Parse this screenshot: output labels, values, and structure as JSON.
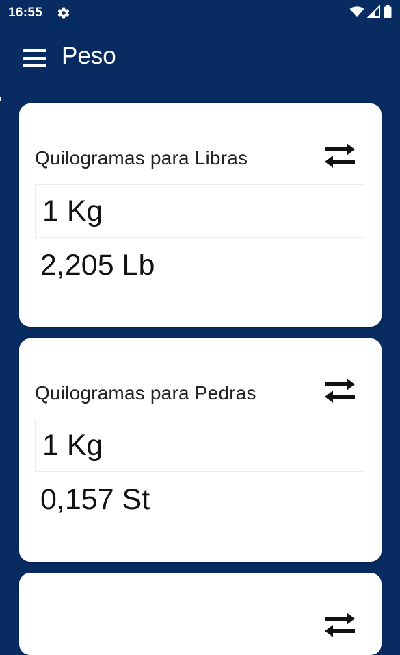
{
  "status_bar": {
    "time": "16:55",
    "icons": [
      "gear-icon",
      "wifi-icon",
      "signal-icon",
      "battery-icon"
    ]
  },
  "app_bar": {
    "title": "Peso",
    "menu_icon": "menu-icon",
    "background_color": "#082b61"
  },
  "converters": [
    {
      "title": "Quilogramas para Libras",
      "input_value": "1 Kg",
      "result": "2,205 Lb",
      "swap_icon": "swap-arrows-icon"
    },
    {
      "title": "Quilogramas para Pedras",
      "input_value": "1 Kg",
      "result": "0,157 St",
      "swap_icon": "swap-arrows-icon"
    }
  ]
}
